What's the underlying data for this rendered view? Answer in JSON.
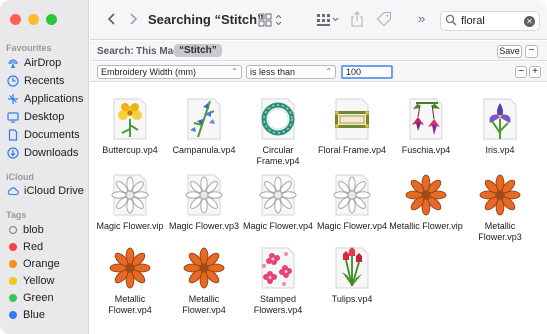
{
  "window": {
    "title": "Searching “Stitch”"
  },
  "sidebar": {
    "favourites_heading": "Favourites",
    "favourites": [
      {
        "label": "AirDrop",
        "icon": "airdrop-icon"
      },
      {
        "label": "Recents",
        "icon": "recents-icon"
      },
      {
        "label": "Applications",
        "icon": "applications-icon"
      },
      {
        "label": "Desktop",
        "icon": "desktop-icon"
      },
      {
        "label": "Documents",
        "icon": "documents-icon"
      },
      {
        "label": "Downloads",
        "icon": "downloads-icon"
      }
    ],
    "icloud_heading": "iCloud",
    "icloud": [
      {
        "label": "iCloud Drive",
        "icon": "cloud-icon"
      }
    ],
    "tags_heading": "Tags",
    "tags": [
      {
        "label": "blob",
        "color": ""
      },
      {
        "label": "Red",
        "color": "#f2453d"
      },
      {
        "label": "Orange",
        "color": "#f7921e"
      },
      {
        "label": "Yellow",
        "color": "#f5c518"
      },
      {
        "label": "Green",
        "color": "#34c759"
      },
      {
        "label": "Blue",
        "color": "#2f7cf6"
      }
    ]
  },
  "search": {
    "value": "floral"
  },
  "scope": {
    "label": "Search:",
    "this_mac": "This Mac",
    "stitch": "“Stitch”",
    "save": "Save",
    "minus": "−"
  },
  "criteria": {
    "attribute": "Embroidery Width (mm)",
    "operator": "is less than",
    "value": "100",
    "minus": "−",
    "plus": "+"
  },
  "files": [
    {
      "name": "Buttercup.vp4",
      "kind": "buttercup"
    },
    {
      "name": "Campanula.vp4",
      "kind": "campanula"
    },
    {
      "name": "Circular Frame.vp4",
      "kind": "circframe"
    },
    {
      "name": "Floral Frame.vp4",
      "kind": "floralframe"
    },
    {
      "name": "Fuschia.vp4",
      "kind": "fuschia"
    },
    {
      "name": "Iris.vp4",
      "kind": "iris"
    },
    {
      "name": "Magic Flower.vip",
      "kind": "magic"
    },
    {
      "name": "Magic Flower.vp3",
      "kind": "magic"
    },
    {
      "name": "Magic Flower.vp4",
      "kind": "magic"
    },
    {
      "name": "Magic Flower.vp4",
      "kind": "magic"
    },
    {
      "name": "Metallic Flower.vip",
      "kind": "metallic"
    },
    {
      "name": "Metallic Flower.vp3",
      "kind": "metallic"
    },
    {
      "name": "Metallic Flower.vp4",
      "kind": "metallic"
    },
    {
      "name": "Metallic Flower.vp4",
      "kind": "metallic"
    },
    {
      "name": "Stamped Flowers.vp4",
      "kind": "stamped"
    },
    {
      "name": "Tulips.vp4",
      "kind": "tulips"
    }
  ]
}
